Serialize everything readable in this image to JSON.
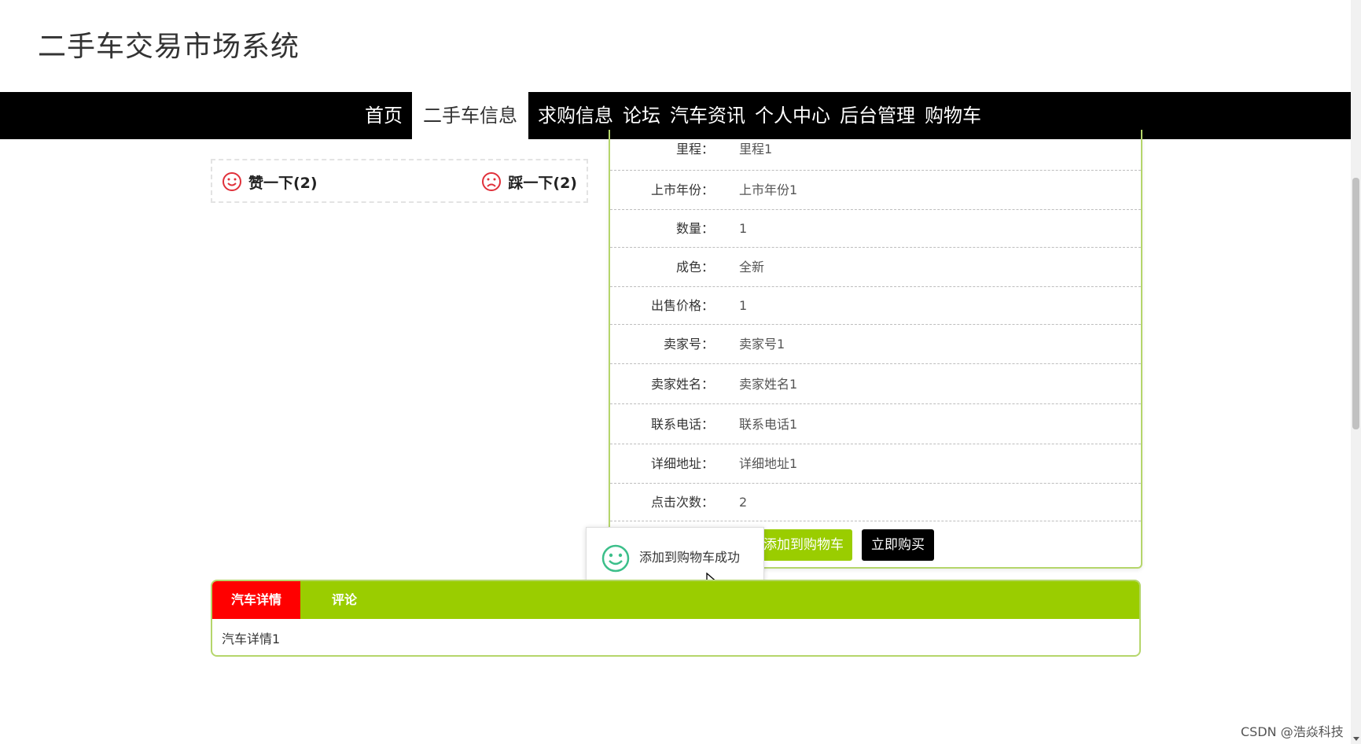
{
  "site": {
    "title": "二手车交易市场系统"
  },
  "nav": {
    "items": [
      "首页",
      "二手车信息",
      "求购信息",
      "论坛",
      "汽车资讯",
      "个人中心",
      "后台管理",
      "购物车"
    ],
    "active_index": 1
  },
  "votes": {
    "like_label": "赞一下(2)",
    "dislike_label": "踩一下(2)"
  },
  "details": [
    {
      "label": "里程：",
      "value": "里程1"
    },
    {
      "label": "上市年份：",
      "value": "上市年份1"
    },
    {
      "label": "数量：",
      "value": "1"
    },
    {
      "label": "成色：",
      "value": "全新"
    },
    {
      "label": "出售价格：",
      "value": "1"
    },
    {
      "label": "卖家号：",
      "value": "卖家号1"
    },
    {
      "label": "卖家姓名：",
      "value": "卖家姓名1"
    },
    {
      "label": "联系电话：",
      "value": "联系电话1"
    },
    {
      "label": "详细地址：",
      "value": "详细地址1"
    },
    {
      "label": "点击次数：",
      "value": "2"
    }
  ],
  "actions": {
    "add_to_cart": "添加到购物车",
    "buy_now": "立即购买"
  },
  "toast": {
    "message": "添加到购物车成功"
  },
  "tabs": {
    "items": [
      "汽车详情",
      "评论"
    ],
    "active_index": 0,
    "content": "汽车详情1"
  },
  "watermark": "CSDN @浩焱科技",
  "colors": {
    "nav_bg": "#000000",
    "accent_green": "#9acd00",
    "active_tab": "#ff0000",
    "vote_icon": "#e0303a"
  }
}
